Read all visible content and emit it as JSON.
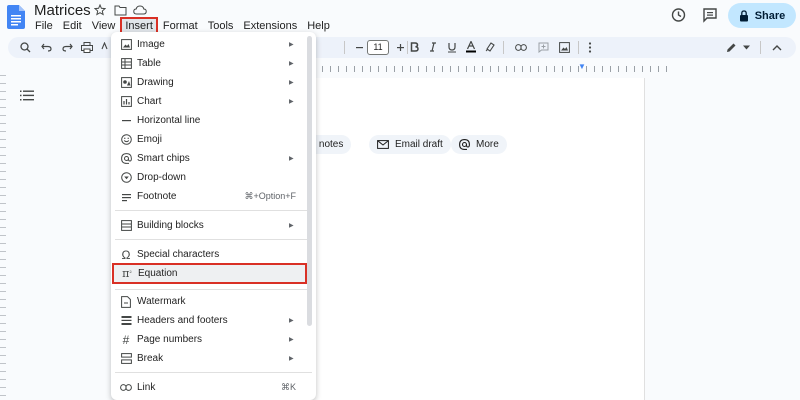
{
  "document": {
    "title": "Matrices"
  },
  "menubar": {
    "items": [
      "File",
      "Edit",
      "View",
      "Insert",
      "Format",
      "Tools",
      "Extensions",
      "Help"
    ],
    "active": "Insert"
  },
  "header": {
    "share_label": "Share"
  },
  "toolbar": {
    "font_size": "11"
  },
  "chips": {
    "meeting_notes": "ting notes",
    "email_draft": "Email draft",
    "more": "More"
  },
  "insert_menu": {
    "items": [
      {
        "label": "Image",
        "icon": "image-icon",
        "submenu": true
      },
      {
        "label": "Table",
        "icon": "table-icon",
        "submenu": true
      },
      {
        "label": "Drawing",
        "icon": "drawing-icon",
        "submenu": true
      },
      {
        "label": "Chart",
        "icon": "chart-icon",
        "submenu": true
      },
      {
        "label": "Horizontal line",
        "icon": "horizontal-line-icon",
        "submenu": false
      },
      {
        "label": "Emoji",
        "icon": "emoji-icon",
        "submenu": false
      },
      {
        "label": "Smart chips",
        "icon": "smart-chips-icon",
        "submenu": true
      },
      {
        "label": "Drop-down",
        "icon": "dropdown-icon",
        "submenu": false
      },
      {
        "label": "Footnote",
        "icon": "footnote-icon",
        "submenu": false,
        "shortcut": "⌘+Option+F"
      },
      {
        "label": "Building blocks",
        "icon": "building-blocks-icon",
        "submenu": true
      },
      {
        "label": "Special characters",
        "icon": "omega-icon",
        "submenu": false
      },
      {
        "label": "Equation",
        "icon": "pi-icon",
        "submenu": false,
        "highlighted": true
      },
      {
        "label": "Watermark",
        "icon": "watermark-icon",
        "submenu": false
      },
      {
        "label": "Headers and footers",
        "icon": "headers-icon",
        "submenu": true
      },
      {
        "label": "Page numbers",
        "icon": "hash-icon",
        "submenu": true
      },
      {
        "label": "Break",
        "icon": "break-icon",
        "submenu": true
      },
      {
        "label": "Link",
        "icon": "link-icon",
        "submenu": false,
        "shortcut": "⌘K"
      }
    ]
  },
  "colors": {
    "accent_highlight": "#d93025",
    "share_bg": "#c2e7ff",
    "docs_blue": "#4285f4"
  }
}
